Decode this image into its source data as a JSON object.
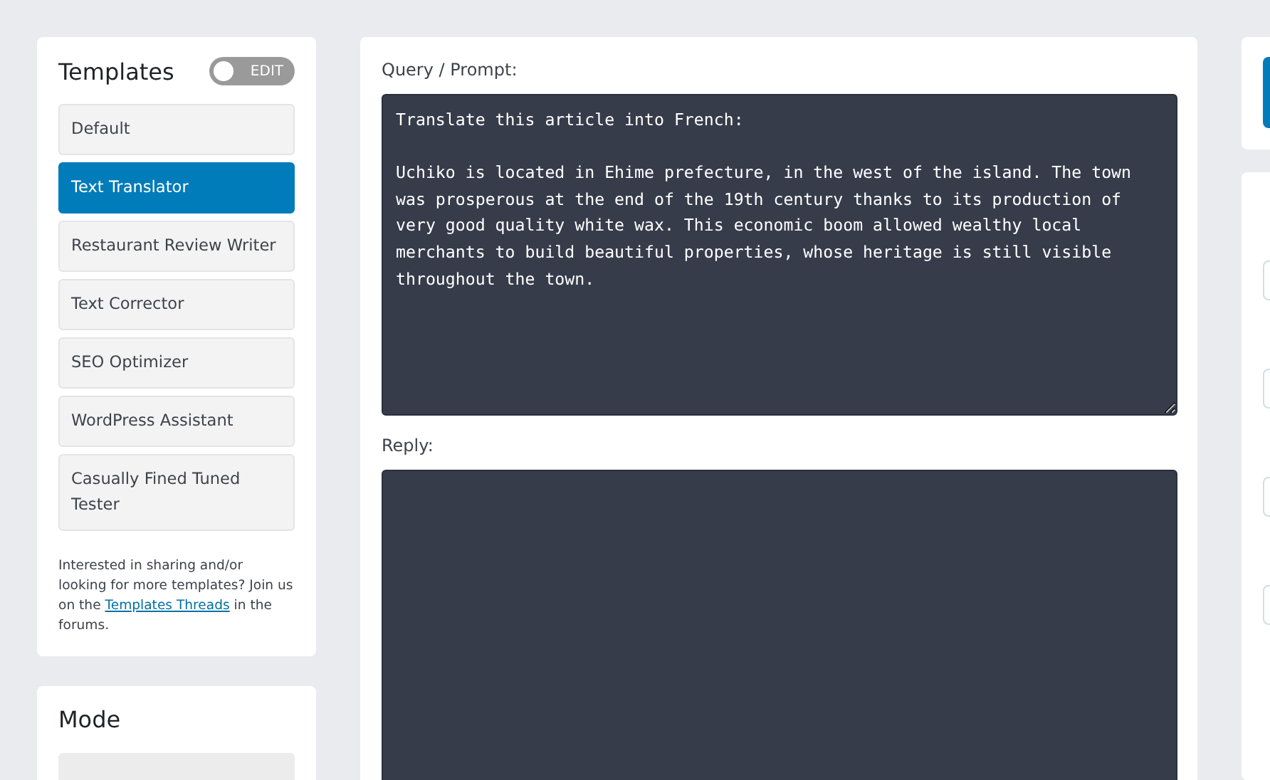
{
  "templates": {
    "title": "Templates",
    "edit_toggle": {
      "label": "EDIT",
      "on": false
    },
    "items": [
      {
        "label": "Default",
        "selected": false
      },
      {
        "label": "Text Translator",
        "selected": true
      },
      {
        "label": "Restaurant Review Writer",
        "selected": false
      },
      {
        "label": "Text Corrector",
        "selected": false
      },
      {
        "label": "SEO Optimizer",
        "selected": false
      },
      {
        "label": "WordPress Assistant",
        "selected": false
      },
      {
        "label": "Casually Fined Tuned Tester",
        "selected": false
      }
    ],
    "note": {
      "before": "Interested in sharing and/or looking for more templates? Join us on the ",
      "link": "Templates Threads",
      "after": " in the forums."
    }
  },
  "mode": {
    "title": "Mode"
  },
  "query": {
    "label": "Query / Prompt:",
    "value": "Translate this article into French:\n\nUchiko is located in Ehime prefecture, in the west of the island. The town was prosperous at the end of the 19th century thanks to its production of very good quality white wax. This economic boom allowed wealthy local merchants to build beautiful properties, whose heritage is still visible throughout the town."
  },
  "reply": {
    "label": "Reply:"
  }
}
